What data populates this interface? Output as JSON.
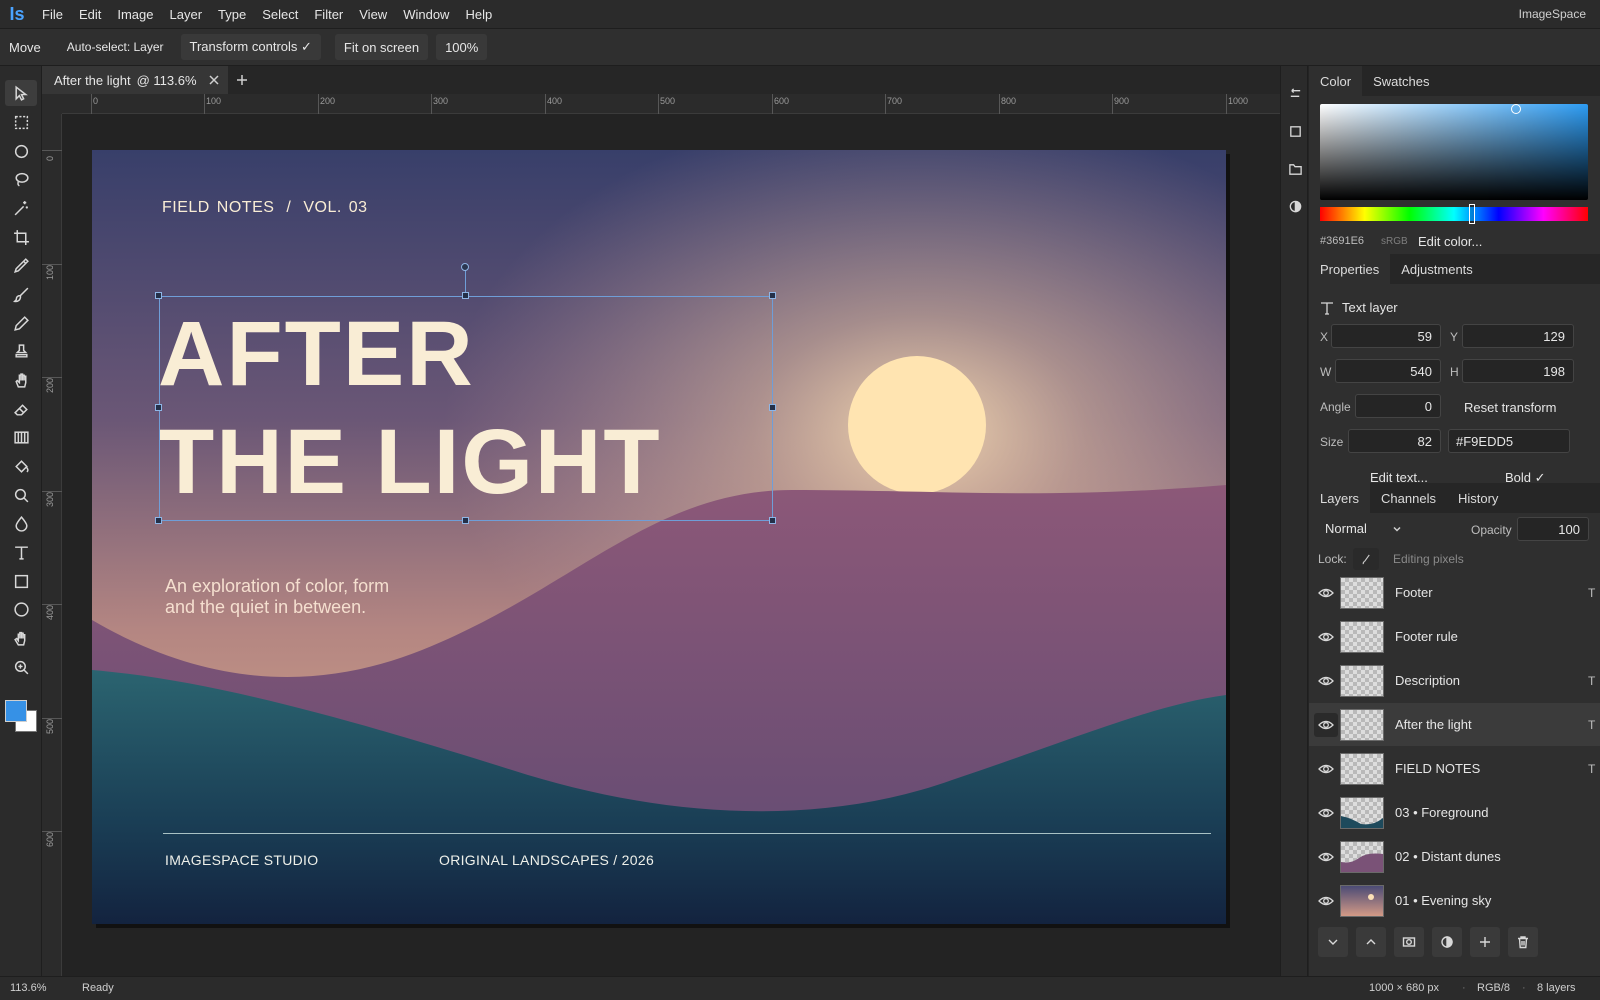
{
  "app": {
    "logo": "Is",
    "name": "ImageSpace"
  },
  "menu": [
    "File",
    "Edit",
    "Image",
    "Layer",
    "Type",
    "Select",
    "Filter",
    "View",
    "Window",
    "Help"
  ],
  "options_bar": {
    "tool": "Move",
    "auto_select": "Auto-select: Layer",
    "transform_controls": "Transform controls ✓",
    "fit_on_screen": "Fit on screen",
    "zoom_100": "100%"
  },
  "tools": [
    "move-icon",
    "marquee-rect-icon",
    "ellipse-select-icon",
    "lasso-icon",
    "magic-wand-icon",
    "crop-icon",
    "eyedropper-icon",
    "brush-icon",
    "pencil-icon",
    "stamp-icon",
    "smudge-hand-icon",
    "eraser-icon",
    "gradient-icon",
    "paint-bucket-icon",
    "zoom-icon",
    "blur-drop-icon",
    "type-icon",
    "rectangle-icon",
    "ellipse-icon",
    "hand-icon",
    "zoom-in-icon"
  ],
  "colors": {
    "foreground": "#3691E6",
    "background": "#FFFFFF",
    "accent": "#3691E6"
  },
  "document_tab": {
    "title": "After the light",
    "zoom": "@ 113.6%"
  },
  "rulers": {
    "horizontal": [
      "0",
      "100",
      "200",
      "300",
      "400",
      "500",
      "600",
      "700",
      "800",
      "900",
      "1000"
    ],
    "vertical": [
      "0",
      "100",
      "200",
      "300",
      "400",
      "500",
      "600"
    ]
  },
  "artboard": {
    "kicker_left": "FIELD NOTES",
    "kicker_sep": "/",
    "kicker_right": "VOL. 03",
    "headline_line1": "AFTER",
    "headline_line2": "THE LIGHT",
    "subtitle_line1": "An exploration of color, form",
    "subtitle_line2": "and the quiet in between.",
    "footer_left": "IMAGESPACE STUDIO",
    "footer_right": "ORIGINAL LANDSCAPES / 2026"
  },
  "color_panel": {
    "tabs": [
      "Color",
      "Swatches"
    ],
    "hex": "#3691E6",
    "space": "sRGB",
    "edit_label": "Edit color..."
  },
  "properties_panel": {
    "tabs": [
      "Properties",
      "Adjustments"
    ],
    "layer_type": "Text layer",
    "x_label": "X",
    "x": "59",
    "y_label": "Y",
    "y": "129",
    "w_label": "W",
    "w": "540",
    "h_label": "H",
    "h": "198",
    "angle_label": "Angle",
    "angle": "0",
    "reset_transform": "Reset transform",
    "size_label": "Size",
    "size": "82",
    "text_color": "#F9EDD5",
    "edit_text": "Edit text...",
    "bold": "Bold ✓"
  },
  "layers_panel": {
    "tabs": [
      "Layers",
      "Channels",
      "History"
    ],
    "blend_mode": "Normal",
    "opacity_label": "Opacity",
    "opacity": "100",
    "lock_label": "Lock:",
    "lock_status": "Editing pixels",
    "layers": [
      {
        "name": "Footer",
        "kind": "T",
        "selected": false
      },
      {
        "name": "Footer rule",
        "kind": "",
        "selected": false
      },
      {
        "name": "Description",
        "kind": "T",
        "selected": false
      },
      {
        "name": "After the light",
        "kind": "T",
        "selected": true
      },
      {
        "name": "FIELD NOTES",
        "kind": "T",
        "selected": false
      },
      {
        "name": "03  •  Foreground",
        "kind": "",
        "selected": false
      },
      {
        "name": "02  •  Distant dunes",
        "kind": "",
        "selected": false
      },
      {
        "name": "01  •  Evening sky",
        "kind": "",
        "selected": false
      }
    ]
  },
  "status_bar": {
    "zoom": "113.6%",
    "state": "Ready",
    "dimensions": "1000 × 680 px",
    "mode": "RGB/8",
    "layers_count": "8 layers"
  }
}
